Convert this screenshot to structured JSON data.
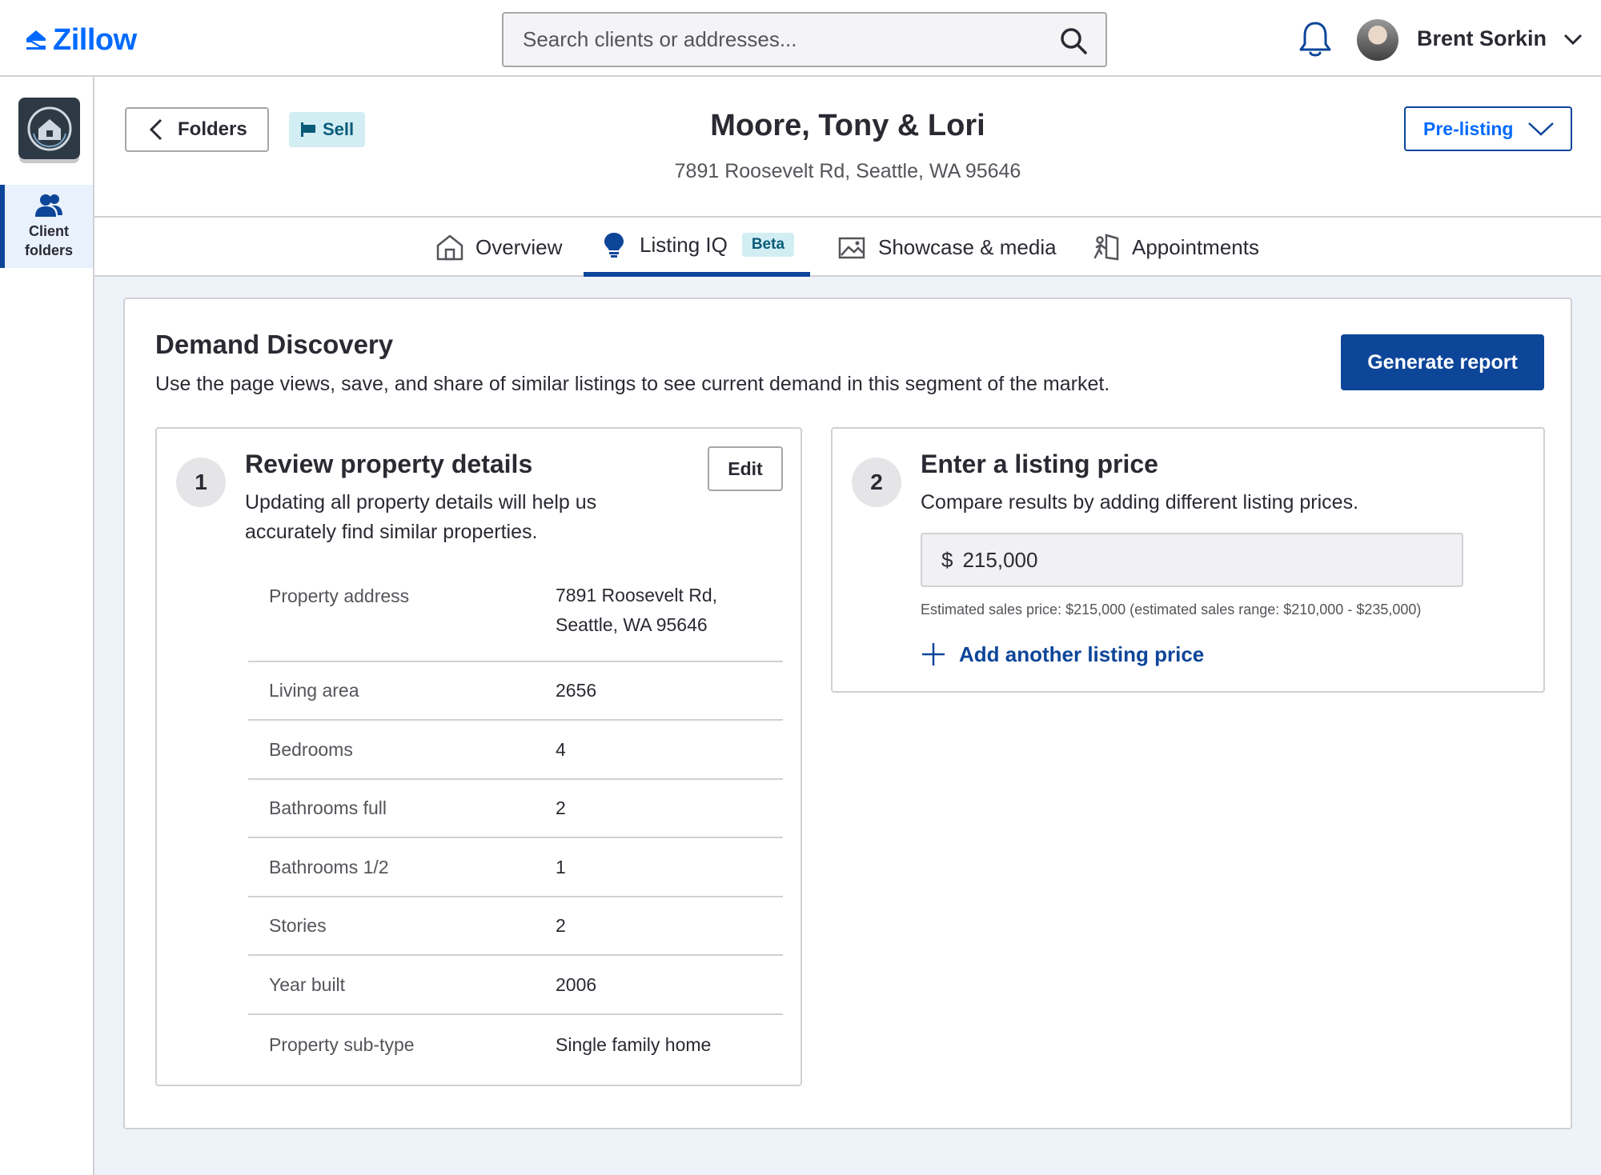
{
  "brand": {
    "name": "Zillow",
    "color": "#006aff"
  },
  "search": {
    "placeholder": "Search clients or addresses...",
    "icon": "search-icon"
  },
  "user": {
    "name": "Brent Sorkin"
  },
  "rail": {
    "items": [
      {
        "label": "Client folders",
        "icon": "people-icon",
        "active": true
      }
    ]
  },
  "client": {
    "back_label": "Folders",
    "type_badge": "Sell",
    "name": "Moore, Tony & Lori",
    "address": "7891 Roosevelt Rd, Seattle, WA 95646",
    "stage": "Pre-listing"
  },
  "tabs": [
    {
      "label": "Overview",
      "icon": "home-icon"
    },
    {
      "label": "Listing IQ",
      "icon": "lightbulb-icon",
      "badge": "Beta",
      "active": true
    },
    {
      "label": "Showcase & media",
      "icon": "image-icon"
    },
    {
      "label": "Appointments",
      "icon": "door-walk-icon"
    }
  ],
  "demand": {
    "title": "Demand Discovery",
    "description": "Use the page views, save, and share of similar listings to see current demand in this segment of the market.",
    "generate_label": "Generate report"
  },
  "step1": {
    "number": "1",
    "title": "Review property details",
    "description": "Updating all property details will help us accurately find similar properties.",
    "edit_label": "Edit",
    "details": [
      {
        "label": "Property address",
        "value": "7891 Roosevelt Rd, Seattle, WA 95646"
      },
      {
        "label": "Living area",
        "value": "2656"
      },
      {
        "label": "Bedrooms",
        "value": "4"
      },
      {
        "label": "Bathrooms full",
        "value": "2"
      },
      {
        "label": "Bathrooms 1/2",
        "value": "1"
      },
      {
        "label": "Stories",
        "value": "2"
      },
      {
        "label": "Year built",
        "value": "2006"
      },
      {
        "label": "Property sub-type",
        "value": "Single family home"
      }
    ]
  },
  "step2": {
    "number": "2",
    "title": "Enter a listing price",
    "description": "Compare results by adding different listing prices.",
    "currency": "$",
    "price_value": "215,000",
    "estimate_note": "Estimated sales price: $215,000 (estimated sales range: $210,000 - $235,000)",
    "add_label": "Add another listing price"
  },
  "colors": {
    "primary": "#0d4599",
    "badge_bg": "#d2eef3",
    "content_bg": "#eef2f9"
  }
}
